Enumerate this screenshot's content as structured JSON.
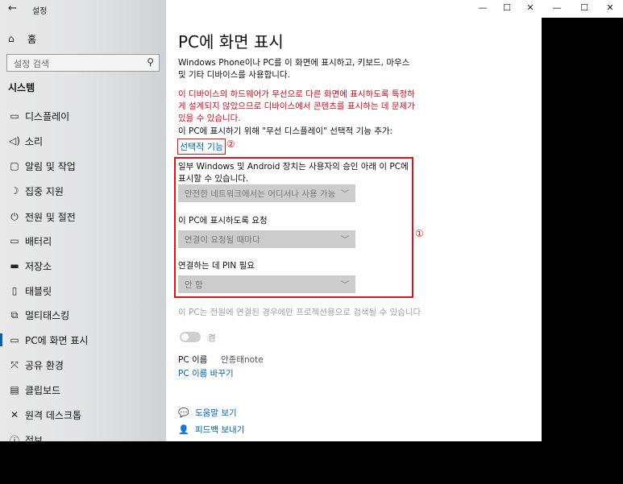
{
  "window": {
    "app_title": "설정",
    "controls": {
      "minimize": "—",
      "maximize": "☐",
      "close": "✕"
    }
  },
  "back_window": {
    "controls": {
      "minimize": "—",
      "maximize": "☐",
      "close": "✕"
    }
  },
  "sidebar": {
    "back_icon": "back-arrow-icon",
    "home_label": "홈",
    "search_placeholder": "설정 검색",
    "section_title": "시스템",
    "items": [
      {
        "label": "디스플레이",
        "icon": "display-icon"
      },
      {
        "label": "소리",
        "icon": "sound-icon"
      },
      {
        "label": "알림 및 작업",
        "icon": "notification-icon"
      },
      {
        "label": "집중 지원",
        "icon": "focus-assist-icon"
      },
      {
        "label": "전원 및 절전",
        "icon": "power-icon"
      },
      {
        "label": "배터리",
        "icon": "battery-icon"
      },
      {
        "label": "저장소",
        "icon": "storage-icon"
      },
      {
        "label": "태블릿",
        "icon": "tablet-icon"
      },
      {
        "label": "멀티태스킹",
        "icon": "multitasking-icon"
      },
      {
        "label": "PC에 화면 표시",
        "icon": "project-icon"
      },
      {
        "label": "공유 환경",
        "icon": "shared-experiences-icon"
      },
      {
        "label": "클립보드",
        "icon": "clipboard-icon"
      },
      {
        "label": "원격 데스크톱",
        "icon": "remote-desktop-icon"
      },
      {
        "label": "정보",
        "icon": "info-icon"
      }
    ],
    "active_index": 9
  },
  "main": {
    "title": "PC에 화면 표시",
    "description": "Windows Phone이나 PC를 이 화면에 표시하고, 키보드, 마우스 및 기타 디바이스를 사용합니다.",
    "warning": "이 디바이스의 하드웨어가 무선으로 다른 화면에 표시하도록 특정하게 설계되지 않았으므로 디바이스에서 콘텐츠를 표시하는 데 문제가 있을 수 있습니다.",
    "add_feature_text": "이 PC에 표시하기 위해 \"무선 디스플레이\" 선택적 기능 추가:",
    "optional_features_link": "선택적 기능",
    "annotation_2": "②",
    "annotation_1": "①",
    "settings": [
      {
        "label": "일부 Windows 및 Android 장치는 사용자의 승인 아래 이 PC에 표시할 수 있습니다.",
        "value": "안전한 네트워크에서는 어디서나 사용 가능"
      },
      {
        "label": "이 PC에 표시하도록 요청",
        "value": "연결이 요청될 때마다"
      },
      {
        "label": "연결하는 데 PIN 필요",
        "value": "안 함"
      }
    ],
    "power_note": "이 PC는 전원에 연결된 경우에만 프로젝션용으로 검색될 수 있습니다",
    "toggle_label": "켬",
    "pc_name_label": "PC 이름",
    "pc_name_value": "안종태note",
    "rename_link": "PC 이름 바꾸기",
    "help_link": "도움말 보기",
    "feedback_link": "피드백 보내기"
  }
}
